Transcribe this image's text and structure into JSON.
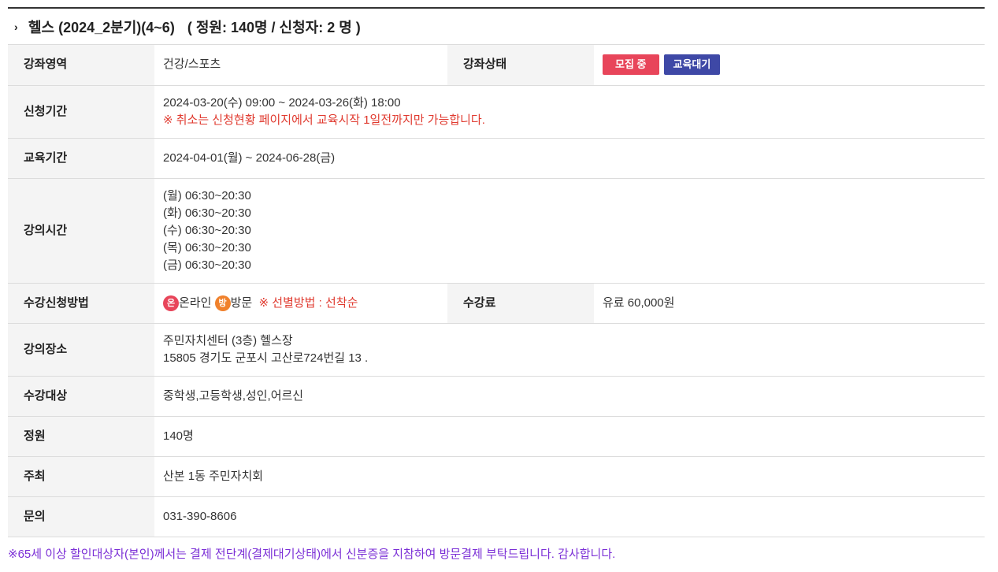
{
  "course": {
    "title": "헬스 (2024_2분기)(4~6)",
    "capacity_summary": "( 정원: 140명 / 신청자: 2 명 )"
  },
  "rows": {
    "area_label": "강좌영역",
    "area_value": "건강/스포츠",
    "status_label": "강좌상태",
    "status_badge1": "모집 중",
    "status_badge2": "교육대기",
    "apply_period_label": "신청기간",
    "apply_period_value": "2024-03-20(수) 09:00 ~ 2024-03-26(화) 18:00",
    "apply_period_note": "※ 취소는 신청현황 페이지에서 교육시작 1일전까지만 가능합니다.",
    "edu_period_label": "교육기간",
    "edu_period_value": "2024-04-01(월) ~ 2024-06-28(금)",
    "lecture_time_label": "강의시간",
    "lecture_times": [
      "(월) 06:30~20:30",
      "(화) 06:30~20:30",
      "(수) 06:30~20:30",
      "(목) 06:30~20:30",
      "(금) 06:30~20:30"
    ],
    "apply_method_label": "수강신청방법",
    "online_icon": "온",
    "online_label": "온라인",
    "visit_icon": "방",
    "visit_label": "방문",
    "selection_note": "※ 선별방법 : 선착순",
    "fee_label": "수강료",
    "fee_value": "유료 60,000원",
    "place_label": "강의장소",
    "place_line1": "주민자치센터 (3층) 헬스장",
    "place_line2": "15805 경기도 군포시 고산로724번길 13 .",
    "target_label": "수강대상",
    "target_value": "중학생,고등학생,성인,어르신",
    "capacity_label": "정원",
    "capacity_value": "140명",
    "host_label": "주최",
    "host_value": "산본 1동 주민자치회",
    "inquiry_label": "문의",
    "inquiry_value": "031-390-8606"
  },
  "footer_note": "※65세 이상 할인대상자(본인)께서는 결제 전단계(결제대기상태)에서 신분증을 지참하여 방문결제 부탁드립니다. 감사합니다.",
  "colors": {
    "red_badge": "#e8455a",
    "blue_badge": "#3e48a6",
    "orange_badge": "#f0812c",
    "note_red": "#e03a2f",
    "footer_purple": "#7b2fd6"
  }
}
